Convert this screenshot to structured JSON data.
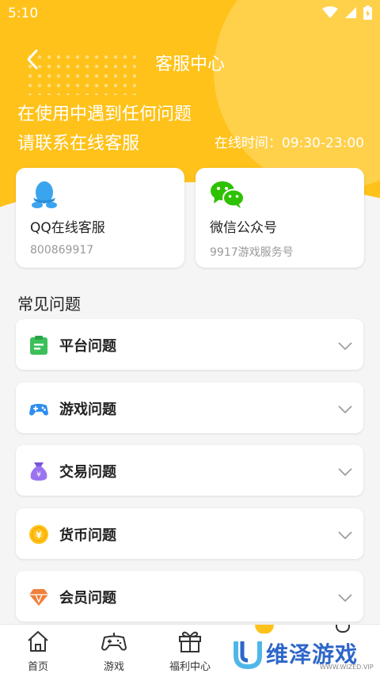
{
  "status_bar": {
    "time": "5:10"
  },
  "header": {
    "title": "客服中心",
    "line1": "在使用中遇到任何问题",
    "line2": "请联系在线客服",
    "hours": "在线时间：09:30-23:00"
  },
  "contacts": [
    {
      "title": "QQ在线客服",
      "subtitle": "800869917",
      "icon": "qq-icon"
    },
    {
      "title": "微信公众号",
      "subtitle": "9917游戏服务号",
      "icon": "wechat-icon"
    }
  ],
  "faq": {
    "title": "常见问题",
    "items": [
      {
        "label": "平台问题",
        "icon": "clipboard-icon"
      },
      {
        "label": "游戏问题",
        "icon": "gamepad-icon"
      },
      {
        "label": "交易问题",
        "icon": "money-bag-icon"
      },
      {
        "label": "货币问题",
        "icon": "coin-icon"
      },
      {
        "label": "会员问题",
        "icon": "diamond-icon"
      }
    ]
  },
  "bottom_nav": [
    {
      "label": "首页",
      "icon": "home-icon"
    },
    {
      "label": "游戏",
      "icon": "gamepad-icon"
    },
    {
      "label": "福利中心",
      "icon": "gift-icon"
    }
  ],
  "watermark": {
    "text": "维泽游戏",
    "sub": "WWW.WIZED.VIP"
  },
  "colors": {
    "accent": "#ffc21a",
    "page_bg": "#f5f5f5",
    "watermark": "#2e66c9"
  }
}
